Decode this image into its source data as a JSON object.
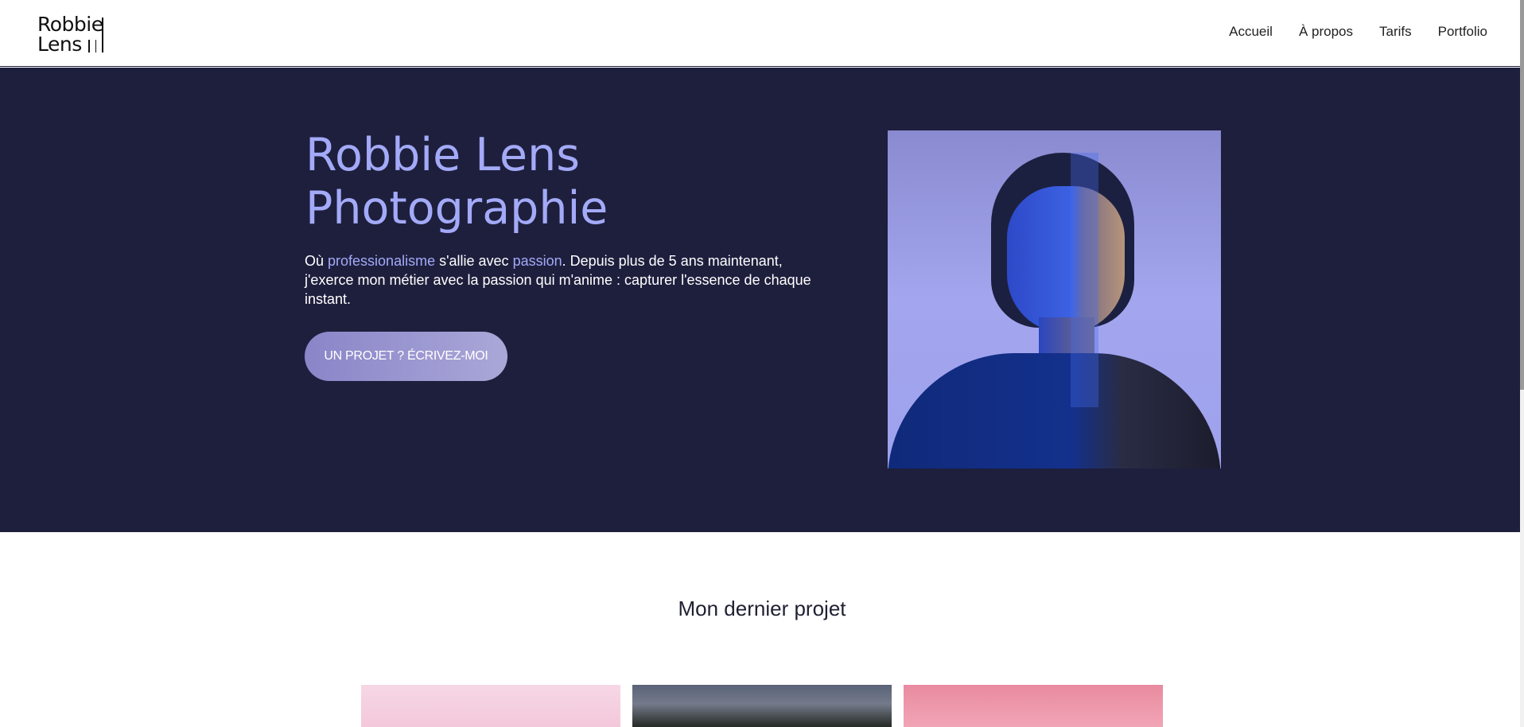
{
  "header": {
    "logo_line1": "Robbie",
    "logo_line2": "Lens",
    "nav": [
      {
        "label": "Accueil"
      },
      {
        "label": "À propos"
      },
      {
        "label": "Tarifs"
      },
      {
        "label": "Portfolio"
      }
    ]
  },
  "hero": {
    "title_line1": "Robbie Lens",
    "title_line2": "Photographie",
    "text_part1": "Où ",
    "text_accent1": "professionalisme",
    "text_part2": " s'allie avec ",
    "text_accent2": "passion",
    "text_part3": ". Depuis plus de 5 ans maintenant, j'exerce mon métier avec la passion qui m'anime : capturer l'essence de chaque instant.",
    "cta_label": "UN PROJET ? ÉCRIVEZ-MOI",
    "accent_color": "#a3aaf8",
    "background_color": "#1e1f3d"
  },
  "section": {
    "title": "Mon dernier projet"
  }
}
